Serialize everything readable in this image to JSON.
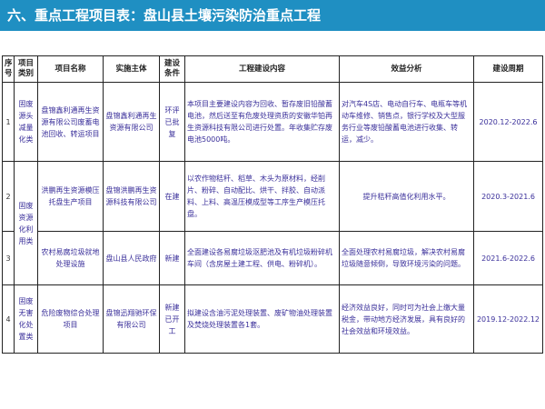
{
  "header": {
    "title": "六、重点工程项目表：盘山县土壤污染防治重点工程"
  },
  "table": {
    "columns": [
      "序号",
      "项目类别",
      "项目名称",
      "实施主体",
      "建设条件",
      "工程建设内容",
      "效益分析",
      "建设周期"
    ],
    "rows": [
      {
        "no": "1",
        "category": "固废源头减量化类",
        "name": "盘锦鑫利通再生资源有限公司废蓄电池回收、转运项目",
        "entity": "盘锦鑫利通再生资源有限公司",
        "condition": "环评已批复",
        "content": "本项目主要建设内容为回收、暂存废旧铅酸蓄电池，然后送至有危废处理资质的安徽华铂再生资源科技有限公司进行处置。年收集贮存废电池5000吨。",
        "benefit": "对汽车4S店、电动自行车、电瓶车等机动车维修、销售点，银行学校及大型服务行业等废铅酸蓄电池进行收集、转运，减少。",
        "period": "2020.12-2022.6"
      },
      {
        "no": "2",
        "category": "固废资源化利用类",
        "name": "洪鹏再生资源模压托盘生产项目",
        "entity": "盘锦洪鹏再生资源科技有限公司",
        "condition": "在建",
        "content": "以农作物秸秆、稻草、木头为原材料，经削片、粉碎、自动配比、烘干、拌胶、自动派料、上料、高温压模成型等工序生产模压托盘。",
        "benefit": "提升秸秆高值化利用水平。",
        "period": "2020.3-2021.6"
      },
      {
        "no": "3",
        "category": "",
        "name": "农村易腐垃圾就地处理设施",
        "entity": "盘山县人民政府",
        "condition": "新建",
        "content": "全面建设各易腐垃圾沤肥池及有机垃圾粉碎机车间（含房屋土建工程、供电、粉碎机）。",
        "benefit": "全面处理农村易腐垃圾，解决农村易腐垃圾随意倾倒，导致环境污染的问题。",
        "period": "2021.6-2022.6"
      },
      {
        "no": "4",
        "category": "固废无害化处置类",
        "name": "危险废物综合处理项目",
        "entity": "盘锦迅翔驰环保有限公司",
        "condition": "新建已开工",
        "content": "拟建设含油污泥处理装置、废矿物油处理装置及焚烧处理装置各1套。",
        "benefit": "经济效益良好，同时可为社会上缴大量税金，带动地方经济发展，具有良好的社会效益和环境效益。",
        "period": "2019.12-2022.12"
      }
    ]
  }
}
